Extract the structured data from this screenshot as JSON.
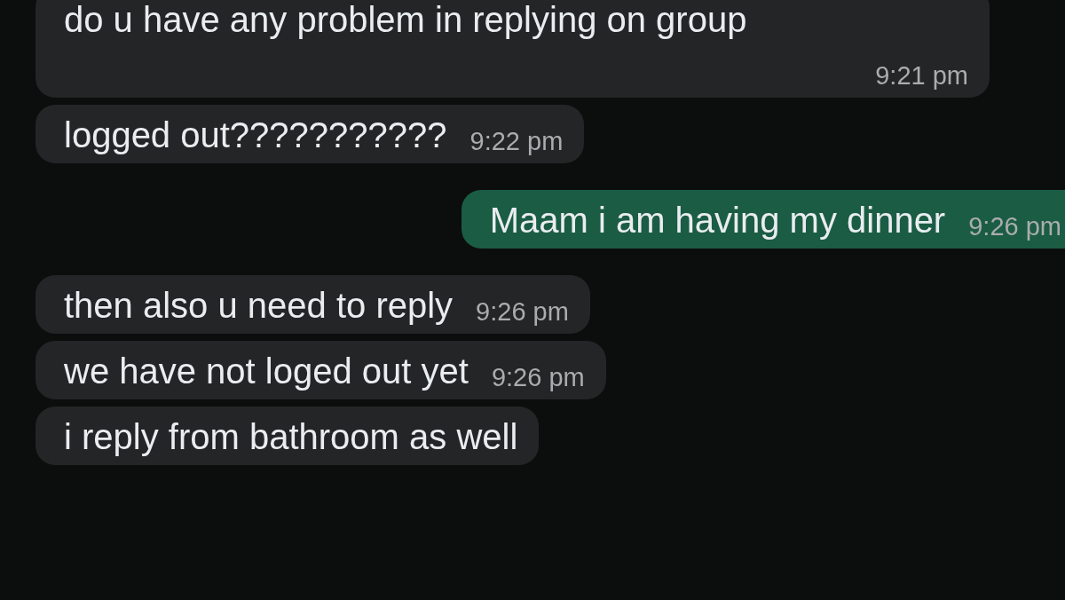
{
  "messages": [
    {
      "kind": "incoming",
      "text": "do u have any problem in replying on group",
      "time": "9:21 pm"
    },
    {
      "kind": "incoming",
      "text": "logged out???????????",
      "time": "9:22 pm"
    },
    {
      "kind": "outgoing",
      "text": "Maam i am having my dinner",
      "time": "9:26 pm"
    },
    {
      "kind": "incoming",
      "text": "then also u need to reply",
      "time": "9:26 pm"
    },
    {
      "kind": "incoming",
      "text": "we have not loged out yet",
      "time": "9:26 pm"
    },
    {
      "kind": "incoming",
      "text": "i reply from bathroom as well"
    }
  ]
}
